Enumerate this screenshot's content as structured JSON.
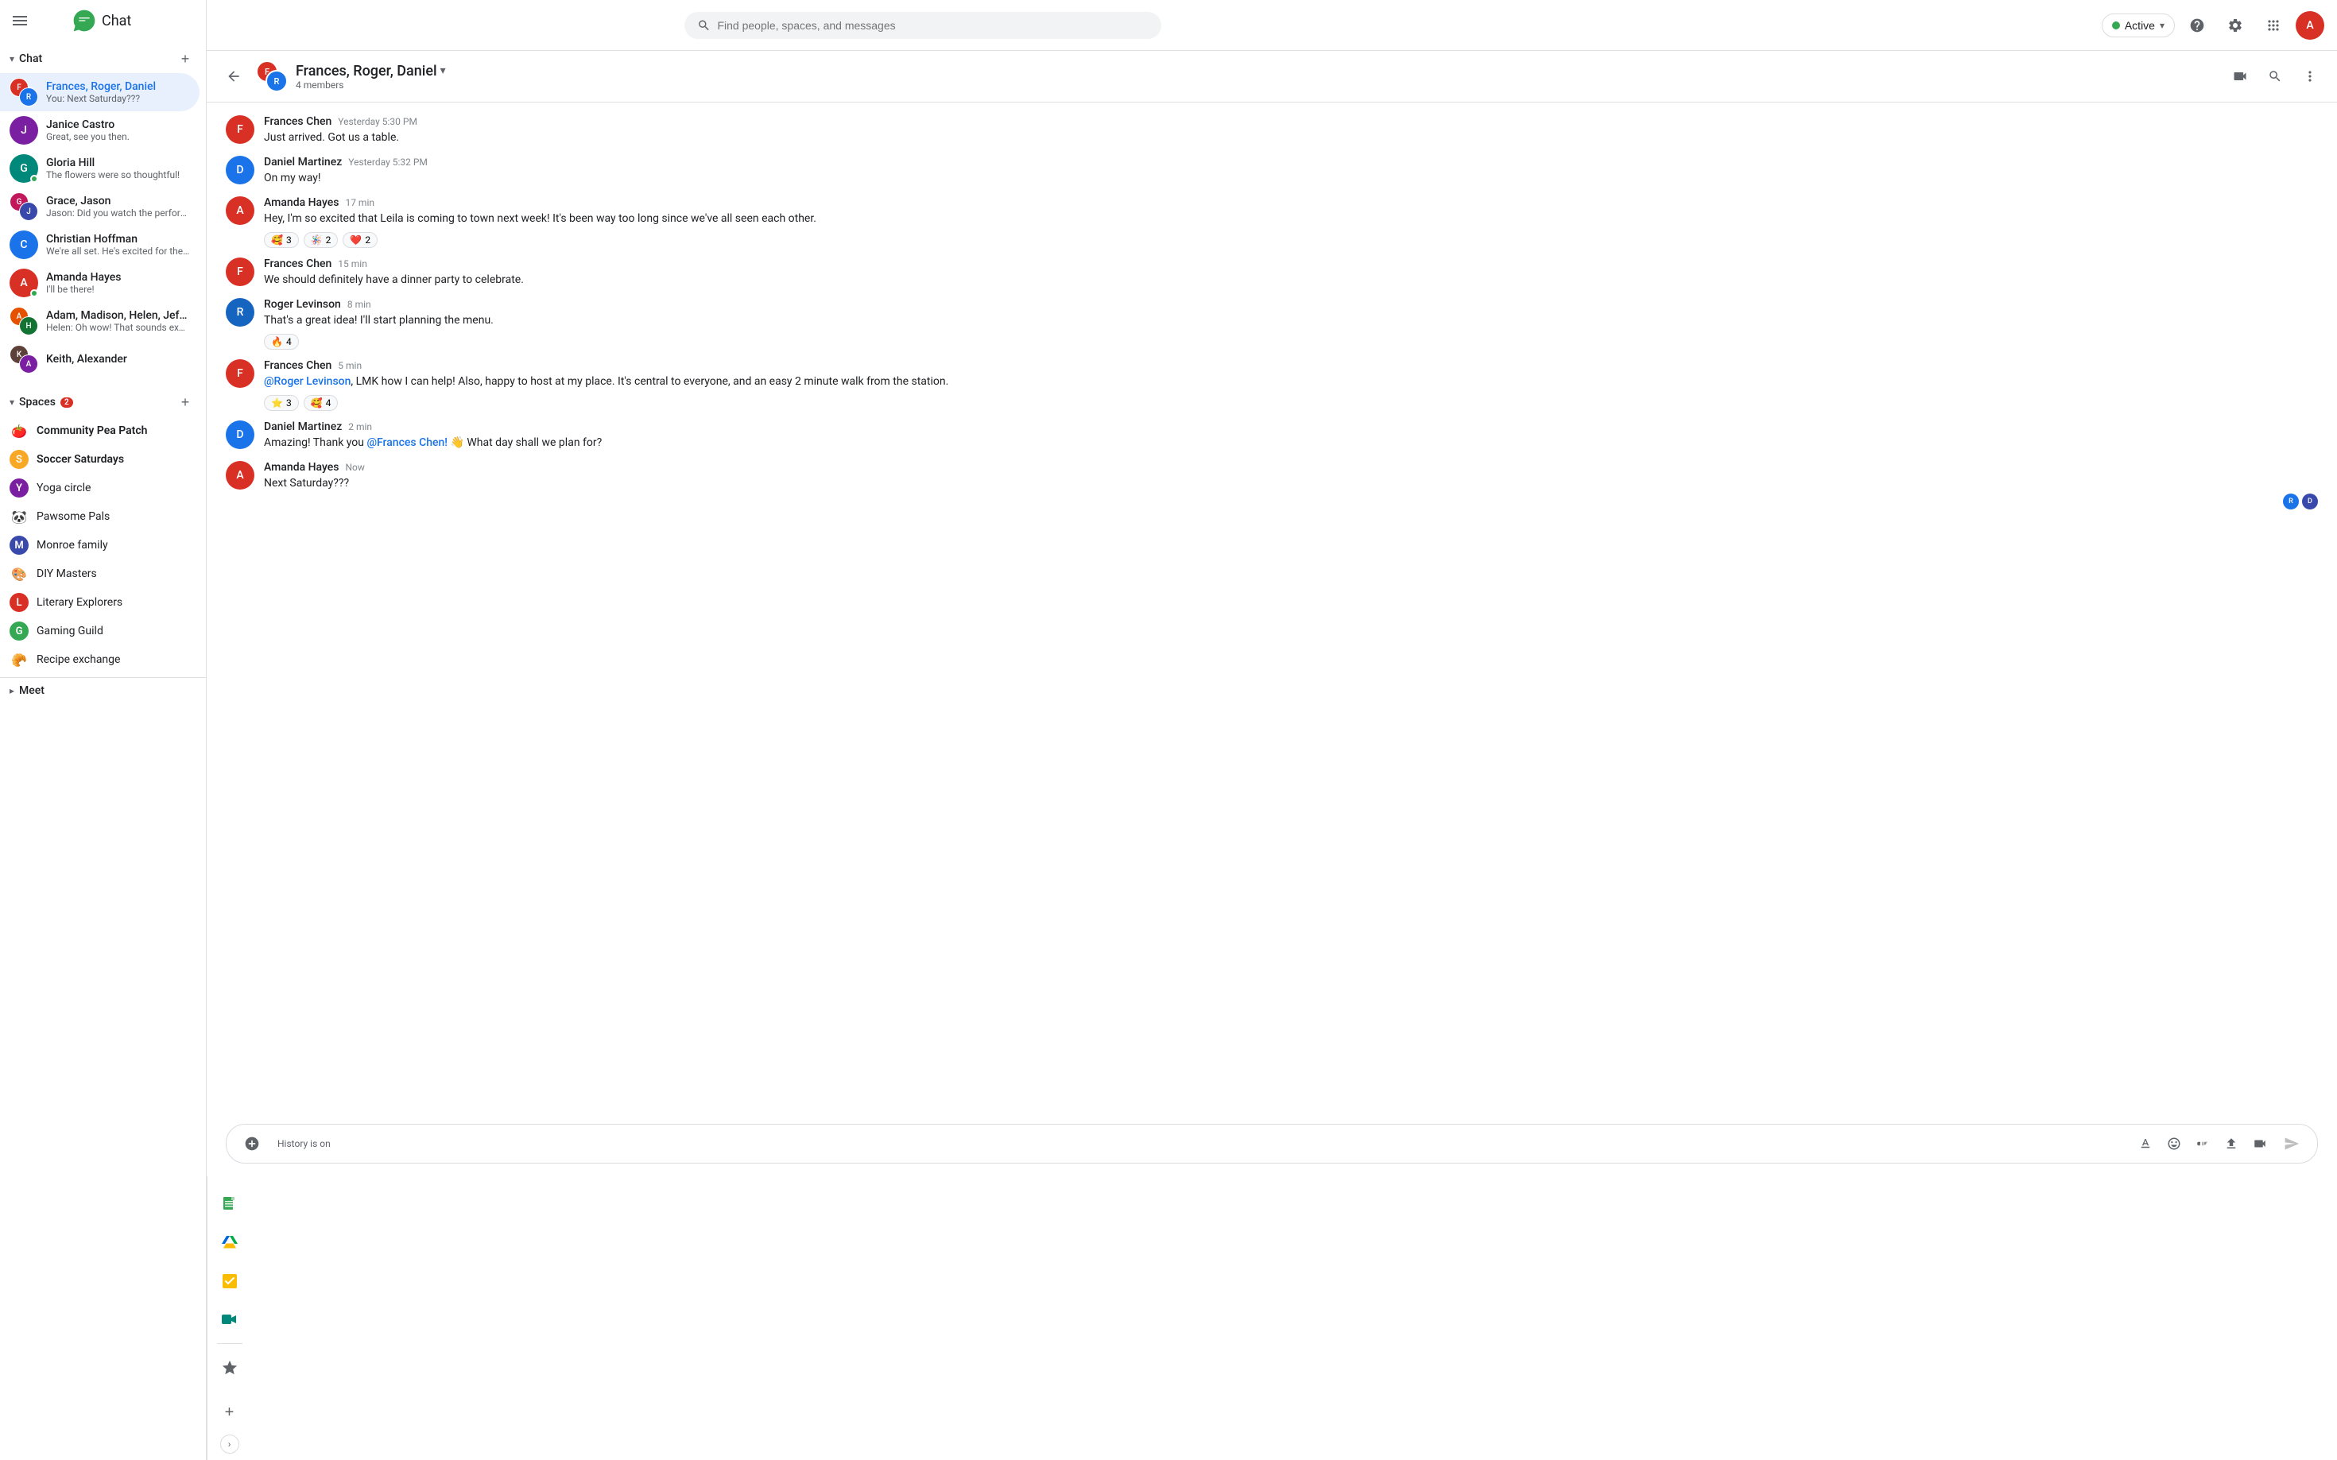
{
  "app": {
    "title": "Chat",
    "logo_emoji": "💬"
  },
  "topbar": {
    "search_placeholder": "Find people, spaces, and messages",
    "status": "Active",
    "status_color": "#34a853"
  },
  "sidebar": {
    "chat_section": "Chat",
    "spaces_section": "Spaces",
    "meet_section": "Meet",
    "spaces_badge": "2",
    "chat_items": [
      {
        "name": "Frances, Roger, Daniel",
        "preview": "You: Next Saturday???",
        "active": true,
        "avatar_type": "group",
        "color1": "#d93025",
        "color2": "#1a73e8",
        "initials1": "F",
        "initials2": "R"
      },
      {
        "name": "Janice Castro",
        "preview": "Great, see you then.",
        "avatar_type": "single",
        "color": "#7b1fa2",
        "initials": "J"
      },
      {
        "name": "Gloria Hill",
        "preview": "The flowers were so thoughtful!",
        "avatar_type": "single",
        "color": "#00897b",
        "initials": "G",
        "online": true
      },
      {
        "name": "Grace, Jason",
        "preview": "Jason: Did you watch the performan ...",
        "avatar_type": "group",
        "color1": "#c2185b",
        "color2": "#3949ab",
        "initials1": "G",
        "initials2": "J"
      },
      {
        "name": "Christian Hoffman",
        "preview": "We're all set.  He's excited for the trip.",
        "avatar_type": "single",
        "color": "#1a73e8",
        "initials": "C"
      },
      {
        "name": "Amanda Hayes",
        "preview": "I'll be there!",
        "avatar_type": "single",
        "color": "#d93025",
        "initials": "A",
        "online": true
      },
      {
        "name": "Adam, Madison, Helen, Jeffrey",
        "preview": "Helen: Oh wow! That sounds exciting ...",
        "avatar_type": "group",
        "color1": "#e65100",
        "color2": "#137333",
        "initials1": "A",
        "initials2": "H"
      },
      {
        "name": "Keith, Alexander",
        "preview": "",
        "avatar_type": "group",
        "color1": "#5d4037",
        "color2": "#7b1fa2",
        "initials1": "K",
        "initials2": "A"
      }
    ],
    "spaces": [
      {
        "name": "Community Pea Patch",
        "bold": true,
        "icon_type": "emoji",
        "icon": "🍅"
      },
      {
        "name": "Soccer Saturdays",
        "bold": true,
        "icon_type": "letter",
        "letter": "S",
        "color": "#f9a825"
      },
      {
        "name": "Yoga circle",
        "bold": false,
        "icon_type": "letter",
        "letter": "Y",
        "color": "#7b1fa2"
      },
      {
        "name": "Pawsome Pals",
        "bold": false,
        "icon_type": "emoji",
        "icon": "🐼"
      },
      {
        "name": "Monroe family",
        "bold": false,
        "icon_type": "letter",
        "letter": "M",
        "color": "#3949ab"
      },
      {
        "name": "DIY Masters",
        "bold": false,
        "icon_type": "emoji",
        "icon": "🎨"
      },
      {
        "name": "Literary Explorers",
        "bold": false,
        "icon_type": "letter",
        "letter": "L",
        "color": "#d93025"
      },
      {
        "name": "Gaming Guild",
        "bold": false,
        "icon_type": "letter",
        "letter": "G",
        "color": "#34a853"
      },
      {
        "name": "Recipe exchange",
        "bold": false,
        "icon_type": "emoji",
        "icon": "🥐"
      }
    ]
  },
  "chat_header": {
    "title": "Frances, Roger, Daniel",
    "members": "4 members"
  },
  "messages": [
    {
      "sender": "Frances Chen",
      "time": "Yesterday 5:30 PM",
      "text": "Just arrived.  Got us a table.",
      "avatar_color": "#d93025",
      "avatar_initials": "F",
      "reactions": []
    },
    {
      "sender": "Daniel Martinez",
      "time": "Yesterday 5:32 PM",
      "text": "On my way!",
      "avatar_color": "#1a73e8",
      "avatar_initials": "D",
      "reactions": []
    },
    {
      "sender": "Amanda Hayes",
      "time": "17 min",
      "text": "Hey, I'm so excited that Leila is coming to town next week! It's been way too long since we've all seen each other.",
      "avatar_color": "#d93025",
      "avatar_initials": "A",
      "reactions": [
        {
          "emoji": "🥰",
          "count": 3
        },
        {
          "emoji": "🪅",
          "count": 2
        },
        {
          "emoji": "❤️",
          "count": 2
        }
      ]
    },
    {
      "sender": "Frances Chen",
      "time": "15 min",
      "text": "We should definitely have a dinner party to celebrate.",
      "avatar_color": "#d93025",
      "avatar_initials": "F",
      "reactions": []
    },
    {
      "sender": "Roger Levinson",
      "time": "8 min",
      "text": "That's a great idea! I'll start planning the menu.",
      "avatar_color": "#1565c0",
      "avatar_initials": "R",
      "reactions": [
        {
          "emoji": "🔥",
          "count": 4
        }
      ]
    },
    {
      "sender": "Frances Chen",
      "time": "5 min",
      "text": "@Roger Levinson, LMK how I can help!  Also, happy to host at my place. It's central to everyone, and an easy 2 minute walk from the station.",
      "avatar_color": "#d93025",
      "avatar_initials": "F",
      "has_mention": true,
      "mention_text": "@Roger Levinson",
      "reactions": [
        {
          "emoji": "⭐",
          "count": 3
        },
        {
          "emoji": "🥰",
          "count": 4
        }
      ]
    },
    {
      "sender": "Daniel Martinez",
      "time": "2 min",
      "text": "Amazing! Thank you @Frances Chen! 👋 What day shall we plan for?",
      "avatar_color": "#1a73e8",
      "avatar_initials": "D",
      "has_mention": true,
      "mention_text": "@Frances Chen!",
      "reactions": []
    },
    {
      "sender": "Amanda Hayes",
      "time": "Now",
      "text": "Next Saturday???",
      "avatar_color": "#d93025",
      "avatar_initials": "A",
      "reactions": [],
      "show_read_avatars": true
    }
  ],
  "input": {
    "placeholder": "History is on"
  },
  "right_sidebar": {
    "add_label": "+",
    "expand_label": "›"
  }
}
